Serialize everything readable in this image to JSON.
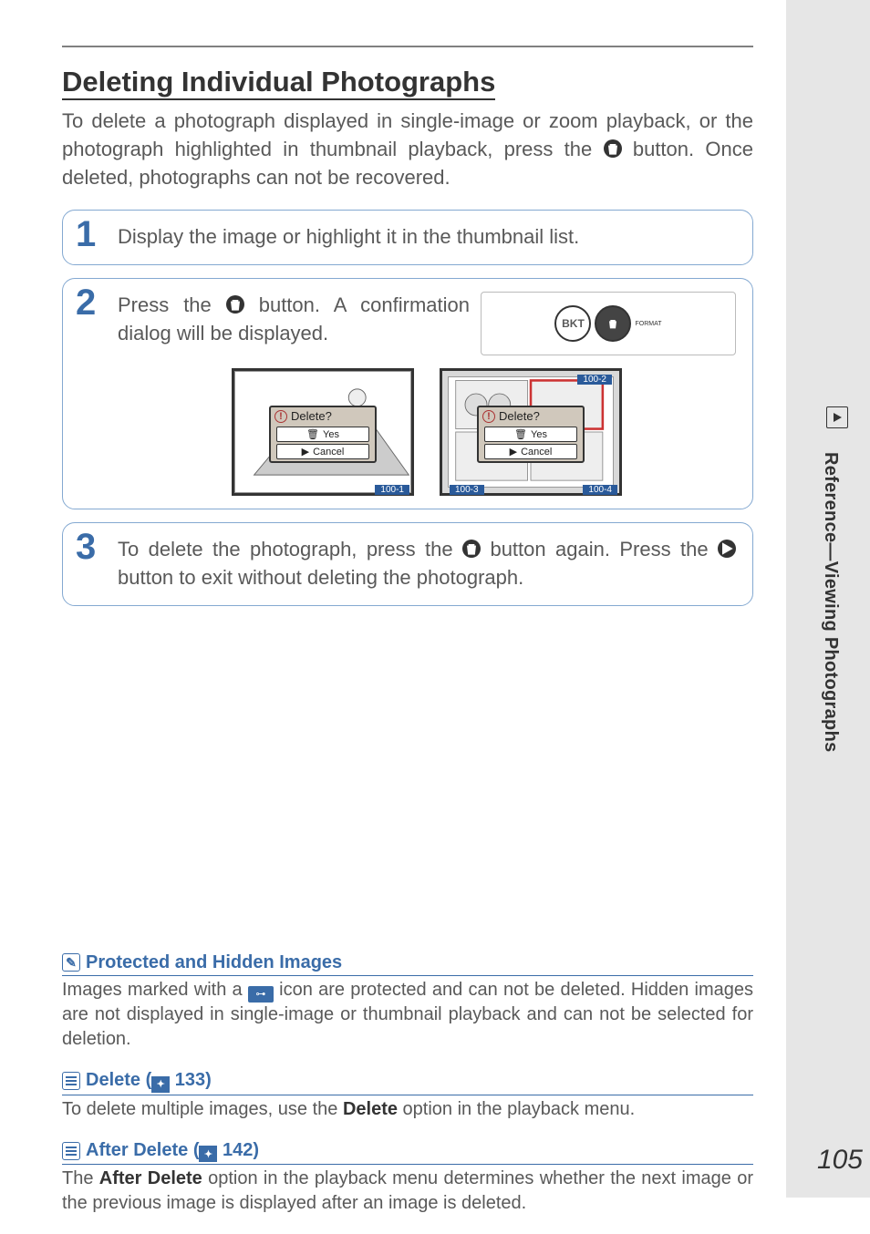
{
  "page_number": "105",
  "side_label": "Reference—Viewing Photographs",
  "heading": "Deleting Individual Photographs",
  "intro_before": "To delete a photograph displayed in single-image or zoom playback, or the photograph highlighted in thumbnail playback, press the ",
  "intro_after": " button.  Once deleted, photographs can not be recovered.",
  "steps": {
    "s1": {
      "num": "1",
      "text": "Display the image or highlight it in the thumbnail list."
    },
    "s2": {
      "num": "2",
      "before": "Press the ",
      "after": " button.  A confirmation dialog will be displayed.",
      "camera_labels": {
        "bkt": "BKT",
        "format": "FORMAT"
      },
      "dialog": {
        "title": "Delete?",
        "yes": "Yes",
        "cancel": "Cancel",
        "frame1": "100-1",
        "frame2a": "100-2",
        "frame2b": "100-3",
        "frame2c": "100-4"
      }
    },
    "s3": {
      "num": "3",
      "p1": "To delete the photograph, press the ",
      "p2": " button again.  Press the ",
      "p3": " button to exit without deleting the photograph."
    }
  },
  "notes": {
    "n1": {
      "title": "Protected and Hidden Images",
      "t1": "Images marked with a ",
      "t2": " icon are protected and can not be deleted.  Hidden images are not displayed in single-image or thumbnail playback and can not be selected for deletion."
    },
    "n2": {
      "title_before": "Delete (",
      "title_ref": " 133)",
      "t1": "To delete multiple images, use the ",
      "bold": "Delete",
      "t2": " option in the playback menu."
    },
    "n3": {
      "title_before": "After Delete (",
      "title_ref": " 142)",
      "t1": "The ",
      "bold": "After Delete",
      "t2": " option in the playback menu determines whether the next image or the previous image is displayed after an image is deleted."
    }
  }
}
